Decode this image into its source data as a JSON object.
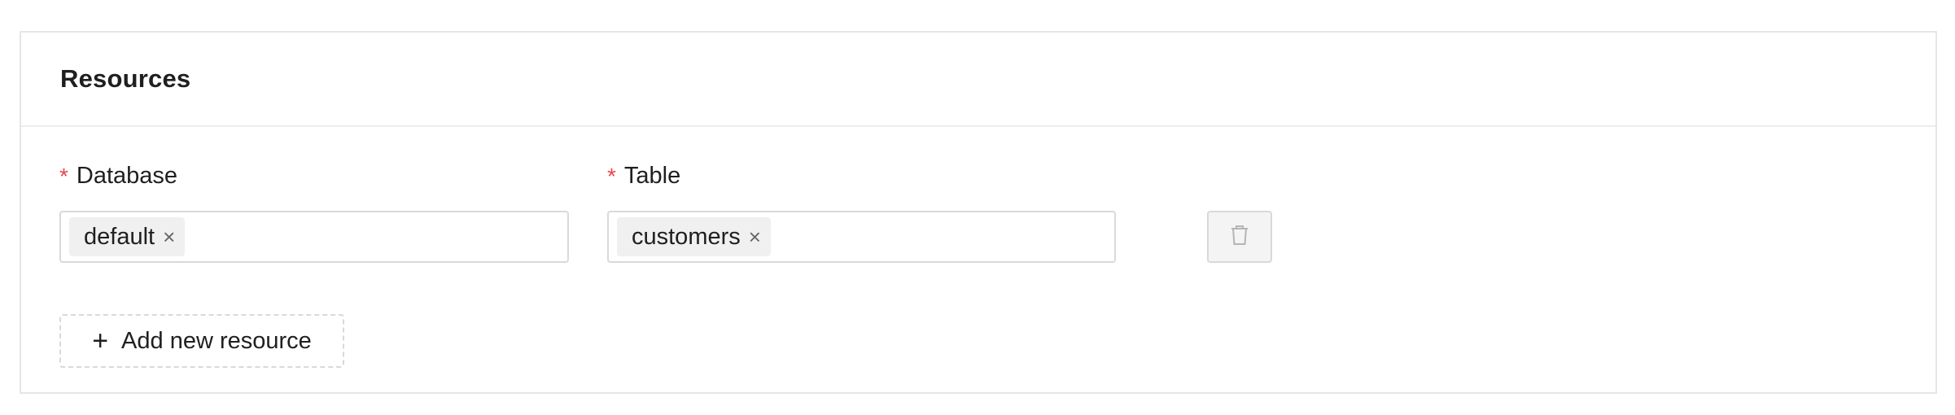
{
  "card": {
    "title": "Resources"
  },
  "fields": {
    "database": {
      "required_marker": "*",
      "label": "Database",
      "tags": [
        "default"
      ]
    },
    "table": {
      "required_marker": "*",
      "label": "Table",
      "tags": [
        "customers"
      ]
    }
  },
  "tag_close_glyph": "×",
  "actions": {
    "delete_icon": "trash-icon",
    "add_label": "Add new resource",
    "add_icon": "plus-icon",
    "add_glyph": "+"
  },
  "colors": {
    "required": "#e5484d",
    "tag_bg": "#f0f0f0",
    "border": "#d9d9d9"
  }
}
